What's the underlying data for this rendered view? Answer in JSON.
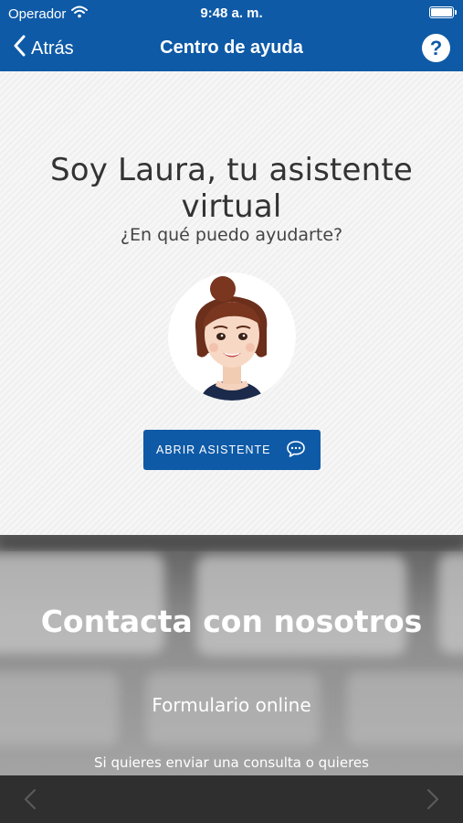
{
  "status_bar": {
    "carrier": "Operador",
    "time": "9:48 a. m."
  },
  "nav": {
    "back_label": "Atrás",
    "title": "Centro de ayuda",
    "help_symbol": "?"
  },
  "assistant": {
    "title": "Soy Laura, tu asistente virtual",
    "subtitle": "¿En qué puedo ayudarte?",
    "button_label": "ABRIR ASISTENTE"
  },
  "contact": {
    "title": "Contacta con nosotros",
    "form_link": "Formulario online",
    "description": "Si quieres enviar una consulta o quieres"
  },
  "colors": {
    "primary": "#0e5aa7",
    "toolbar": "#2f2f2f"
  },
  "icons": {
    "back": "chevron-left-icon",
    "help": "question-circle-icon",
    "chat": "chat-bubble-icon",
    "wifi": "wifi-icon",
    "battery": "battery-icon",
    "toolbar_back": "chevron-left-icon",
    "toolbar_forward": "chevron-right-icon"
  }
}
